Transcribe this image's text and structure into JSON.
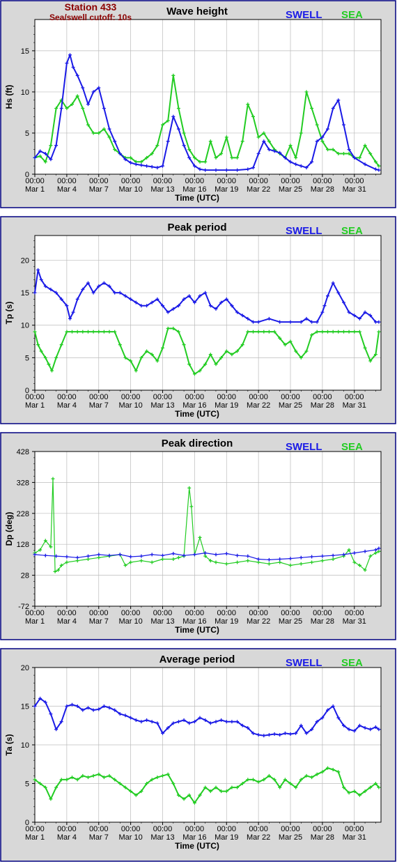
{
  "header": {
    "station": "Station 433",
    "cutoff": "Sea/swell cutoff: 10s"
  },
  "colors": {
    "swell": "#1a1ae6",
    "sea": "#22cc22",
    "frame": "#000080",
    "plot_bg": "#ffffff",
    "outer_bg": "#d8d8d8",
    "header": "#8b0000",
    "grid": "#bbbbbb"
  },
  "legend": {
    "swell": "SWELL",
    "sea": "SEA"
  },
  "x_axis": {
    "label": "Time (UTC)",
    "range_days": [
      0,
      32.5
    ],
    "ticks": [
      {
        "day": 0,
        "time": "00:00",
        "date": "Mar 1"
      },
      {
        "day": 3,
        "time": "00:00",
        "date": "Mar 4"
      },
      {
        "day": 6,
        "time": "00:00",
        "date": "Mar 7"
      },
      {
        "day": 9,
        "time": "00:00",
        "date": "Mar 10"
      },
      {
        "day": 12,
        "time": "00:00",
        "date": "Mar 13"
      },
      {
        "day": 15,
        "time": "00:00",
        "date": "Mar 16"
      },
      {
        "day": 18,
        "time": "00:00",
        "date": "Mar 19"
      },
      {
        "day": 21,
        "time": "00:00",
        "date": "Mar 22"
      },
      {
        "day": 24,
        "time": "00:00",
        "date": "Mar 25"
      },
      {
        "day": 27,
        "time": "00:00",
        "date": "Mar 28"
      },
      {
        "day": 30,
        "time": "00:00",
        "date": "Mar 31"
      }
    ]
  },
  "chart_data": [
    {
      "type": "line",
      "title": "Wave height",
      "ylabel": "Hs (ft)",
      "ylim": [
        0,
        18.8
      ],
      "yticks": [
        0,
        5,
        10,
        15
      ],
      "series": [
        {
          "name": "SWELL",
          "x": [
            0,
            0.5,
            1,
            1.5,
            2,
            2.5,
            3,
            3.3,
            3.6,
            4,
            4.5,
            5,
            5.5,
            6,
            6.5,
            7,
            7.5,
            8,
            8.5,
            9,
            9.5,
            10,
            10.5,
            11,
            11.5,
            12,
            12.5,
            13,
            13.5,
            14,
            14.5,
            15,
            15.5,
            16,
            17,
            18,
            19,
            20,
            20.5,
            21,
            21.5,
            22,
            22.5,
            23,
            23.5,
            24,
            24.5,
            25,
            25.5,
            26,
            26.5,
            27,
            27.5,
            28,
            28.5,
            29,
            29.5,
            30,
            31,
            32,
            32.3
          ],
          "y": [
            2,
            2.8,
            2.5,
            1.8,
            3.5,
            8,
            13.5,
            14.5,
            13,
            12,
            10.5,
            8.5,
            10,
            10.5,
            8,
            5.5,
            4,
            2.5,
            1.8,
            1.4,
            1.2,
            1.1,
            1,
            0.9,
            0.8,
            1,
            4,
            7,
            5.5,
            3.5,
            2,
            1,
            0.6,
            0.5,
            0.5,
            0.5,
            0.5,
            0.6,
            0.8,
            2.5,
            4,
            3,
            2.8,
            2.6,
            2,
            1.5,
            1.2,
            1,
            0.8,
            1.5,
            4,
            4.5,
            5.5,
            8,
            9,
            6,
            3,
            2,
            1.2,
            0.6,
            0.5
          ]
        },
        {
          "name": "SEA",
          "x": [
            0,
            0.5,
            1,
            1.5,
            2,
            2.5,
            3,
            3.5,
            4,
            4.5,
            5,
            5.5,
            6,
            6.5,
            7,
            7.5,
            8,
            8.5,
            9,
            9.5,
            10,
            10.5,
            11,
            11.5,
            12,
            12.5,
            13,
            13.5,
            14,
            14.5,
            15,
            15.5,
            16,
            16.5,
            17,
            17.5,
            18,
            18.5,
            19,
            19.5,
            20,
            20.5,
            21,
            21.5,
            22,
            22.5,
            23,
            23.5,
            24,
            24.5,
            25,
            25.5,
            26,
            26.5,
            27,
            27.5,
            28,
            28.5,
            29,
            29.5,
            30,
            30.5,
            31,
            31.5,
            32,
            32.3
          ],
          "y": [
            2,
            2.2,
            1.5,
            3.5,
            8,
            9,
            8,
            8.5,
            9.5,
            8,
            6,
            5,
            5,
            5.5,
            4.5,
            3,
            2.5,
            2,
            2,
            1.5,
            1.5,
            2,
            2.5,
            3.5,
            6,
            6.5,
            12,
            8,
            5,
            3,
            2,
            1.5,
            1.5,
            4,
            2,
            2.5,
            4.5,
            2,
            2,
            4,
            8.5,
            7,
            4.5,
            5,
            4,
            3,
            2.5,
            2,
            3.5,
            2,
            5,
            10,
            8,
            6,
            4,
            3,
            3,
            2.5,
            2.5,
            2.5,
            2,
            2,
            3.5,
            2.5,
            1.5,
            1
          ]
        }
      ]
    },
    {
      "type": "line",
      "title": "Peak period",
      "ylabel": "Tp (s)",
      "ylim": [
        0,
        23.8
      ],
      "yticks": [
        0,
        5,
        10,
        15,
        20
      ],
      "series": [
        {
          "name": "SWELL",
          "x": [
            0,
            0.3,
            0.6,
            1,
            1.5,
            2,
            2.5,
            3,
            3.3,
            3.6,
            4,
            4.5,
            5,
            5.5,
            6,
            6.5,
            7,
            7.5,
            8,
            8.5,
            9,
            9.5,
            10,
            10.5,
            11,
            11.5,
            12,
            12.5,
            13,
            13.5,
            14,
            14.5,
            15,
            15.5,
            16,
            16.5,
            17,
            17.5,
            18,
            18.5,
            19,
            19.5,
            20,
            20.5,
            21,
            22,
            23,
            24,
            25,
            25.5,
            26,
            26.5,
            27,
            27.2,
            27.5,
            28,
            28.5,
            29,
            29.5,
            30,
            30.5,
            31,
            31.5,
            32,
            32.3
          ],
          "y": [
            15,
            18.5,
            17,
            16,
            15.5,
            15,
            14,
            13,
            11,
            12,
            14,
            15.5,
            16.5,
            15,
            16,
            16.5,
            16,
            15,
            15,
            14.5,
            14,
            13.5,
            13,
            13,
            13.5,
            14,
            13,
            12,
            12.5,
            13,
            14,
            14.5,
            13.5,
            14.5,
            15,
            13,
            12.5,
            13.5,
            14,
            13,
            12,
            11.5,
            11,
            10.5,
            10.5,
            11,
            10.5,
            10.5,
            10.5,
            11,
            10.5,
            10.5,
            12,
            13,
            14.5,
            16.5,
            15,
            13.5,
            12,
            11.5,
            11,
            12,
            11.5,
            10.5,
            10.5
          ]
        },
        {
          "name": "SEA",
          "x": [
            0,
            0.3,
            0.6,
            1,
            1.3,
            1.6,
            2,
            2.5,
            3,
            3.5,
            4,
            4.5,
            5,
            5.5,
            6,
            6.5,
            7,
            7.5,
            8,
            8.5,
            9,
            9.5,
            10,
            10.5,
            11,
            11.5,
            12,
            12.5,
            13,
            13.5,
            14,
            14.5,
            15,
            15.5,
            16,
            16.5,
            17,
            17.5,
            18,
            18.5,
            19,
            19.5,
            20,
            20.5,
            21,
            21.5,
            22,
            22.5,
            23,
            23.5,
            24,
            24.5,
            25,
            25.5,
            26,
            26.5,
            27,
            27.5,
            28,
            28.5,
            29,
            29.5,
            30,
            30.5,
            31,
            31.5,
            32,
            32.3
          ],
          "y": [
            9,
            7,
            6,
            5,
            4,
            3,
            5,
            7,
            9,
            9,
            9,
            9,
            9,
            9,
            9,
            9,
            9,
            9,
            7,
            5,
            4.5,
            3,
            5,
            6,
            5.5,
            4.5,
            6.5,
            9.5,
            9.5,
            9,
            7,
            4,
            2.5,
            3,
            4,
            5.5,
            4,
            5,
            6,
            5.5,
            6,
            7,
            9,
            9,
            9,
            9,
            9,
            9,
            8,
            7,
            7.5,
            6,
            5,
            6,
            8.5,
            9,
            9,
            9,
            9,
            9,
            9,
            9,
            9,
            9,
            6.5,
            4.5,
            5.5,
            9
          ]
        }
      ]
    },
    {
      "type": "scatter",
      "title": "Peak direction",
      "ylabel": "Dp (deg)",
      "ylim": [
        -72,
        428
      ],
      "yticks": [
        -72,
        28,
        128,
        228,
        328,
        428
      ],
      "series": [
        {
          "name": "SWELL",
          "x": [
            0,
            1,
            2,
            3,
            4,
            5,
            6,
            7,
            8,
            9,
            10,
            11,
            12,
            13,
            14,
            15,
            16,
            17,
            18,
            19,
            20,
            21,
            22,
            23,
            24,
            25,
            26,
            27,
            28,
            29,
            30,
            31,
            32,
            32.3
          ],
          "y": [
            95,
            92,
            90,
            88,
            85,
            90,
            95,
            92,
            95,
            88,
            90,
            95,
            92,
            98,
            92,
            95,
            100,
            95,
            98,
            92,
            90,
            80,
            78,
            80,
            82,
            85,
            88,
            90,
            92,
            95,
            100,
            105,
            110,
            115
          ]
        },
        {
          "name": "SEA",
          "x": [
            0,
            0.5,
            1,
            1.5,
            1.7,
            1.9,
            2.2,
            2.5,
            3,
            4,
            5,
            6,
            7,
            8,
            8.5,
            9,
            10,
            11,
            12,
            13,
            13.5,
            14,
            14.5,
            14.7,
            15,
            15.5,
            16,
            16.5,
            17,
            18,
            19,
            20,
            21,
            22,
            23,
            24,
            25,
            26,
            27,
            28,
            29,
            29.5,
            30,
            30.5,
            31,
            31.5,
            32,
            32.3
          ],
          "y": [
            100,
            110,
            140,
            120,
            340,
            40,
            45,
            60,
            70,
            75,
            80,
            85,
            90,
            95,
            60,
            70,
            75,
            70,
            80,
            80,
            85,
            90,
            310,
            250,
            95,
            150,
            90,
            75,
            70,
            65,
            70,
            75,
            70,
            65,
            70,
            60,
            65,
            70,
            75,
            80,
            90,
            110,
            70,
            60,
            45,
            90,
            100,
            105
          ]
        }
      ]
    },
    {
      "type": "line",
      "title": "Average period",
      "ylabel": "Ta (s)",
      "ylim": [
        0,
        20
      ],
      "yticks": [
        0,
        5,
        10,
        15,
        20
      ],
      "series": [
        {
          "name": "SWELL",
          "x": [
            0,
            0.5,
            1,
            1.5,
            2,
            2.5,
            3,
            3.5,
            4,
            4.5,
            5,
            5.5,
            6,
            6.5,
            7,
            7.5,
            8,
            8.5,
            9,
            9.5,
            10,
            10.5,
            11,
            11.5,
            12,
            12.5,
            13,
            13.5,
            14,
            14.5,
            15,
            15.5,
            16,
            16.5,
            17,
            17.5,
            18,
            18.5,
            19,
            19.5,
            20,
            20.5,
            21,
            21.5,
            22,
            22.5,
            23,
            23.5,
            24,
            24.5,
            25,
            25.5,
            26,
            26.5,
            27,
            27.5,
            28,
            28.5,
            29,
            29.5,
            30,
            30.5,
            31,
            31.5,
            32,
            32.3
          ],
          "y": [
            15,
            16,
            15.5,
            14,
            12,
            13,
            15,
            15.2,
            15,
            14.5,
            14.8,
            14.5,
            14.6,
            15,
            14.8,
            14.5,
            14,
            13.8,
            13.5,
            13.2,
            13,
            13.2,
            13,
            12.8,
            11.5,
            12.2,
            12.8,
            13,
            13.2,
            12.8,
            13,
            13.5,
            13.2,
            12.8,
            13,
            13.2,
            13,
            13,
            13,
            12.5,
            12.2,
            11.5,
            11.3,
            11.2,
            11.3,
            11.4,
            11.3,
            11.5,
            11.4,
            11.5,
            12.5,
            11.5,
            12,
            13,
            13.5,
            14.5,
            15,
            13.5,
            12.5,
            12,
            11.8,
            12.5,
            12.2,
            12,
            12.3,
            12
          ]
        },
        {
          "name": "SEA",
          "x": [
            0,
            0.5,
            1,
            1.5,
            2,
            2.5,
            3,
            3.5,
            4,
            4.5,
            5,
            5.5,
            6,
            6.5,
            7,
            7.5,
            8,
            8.5,
            9,
            9.5,
            10,
            10.5,
            11,
            11.5,
            12,
            12.5,
            13,
            13.5,
            14,
            14.5,
            15,
            15.5,
            16,
            16.5,
            17,
            17.5,
            18,
            18.5,
            19,
            19.5,
            20,
            20.5,
            21,
            21.5,
            22,
            22.5,
            23,
            23.5,
            24,
            24.5,
            25,
            25.5,
            26,
            26.5,
            27,
            27.5,
            28,
            28.5,
            29,
            29.5,
            30,
            30.5,
            31,
            31.5,
            32,
            32.3
          ],
          "y": [
            5.5,
            5,
            4.5,
            3,
            4.5,
            5.5,
            5.5,
            5.8,
            5.5,
            6,
            5.8,
            6,
            6.2,
            5.8,
            6,
            5.5,
            5,
            4.5,
            4,
            3.5,
            4,
            5,
            5.5,
            5.8,
            6,
            6.2,
            5,
            3.5,
            3,
            3.5,
            2.5,
            3.5,
            4.5,
            4,
            4.5,
            4,
            4,
            4.5,
            4.5,
            5,
            5.5,
            5.5,
            5.2,
            5.5,
            6,
            5.5,
            4.5,
            5.5,
            5,
            4.5,
            5.5,
            6,
            5.8,
            6.2,
            6.5,
            7,
            6.8,
            6.5,
            4.5,
            3.8,
            4,
            3.5,
            4,
            4.5,
            5,
            4.5
          ]
        }
      ]
    }
  ]
}
